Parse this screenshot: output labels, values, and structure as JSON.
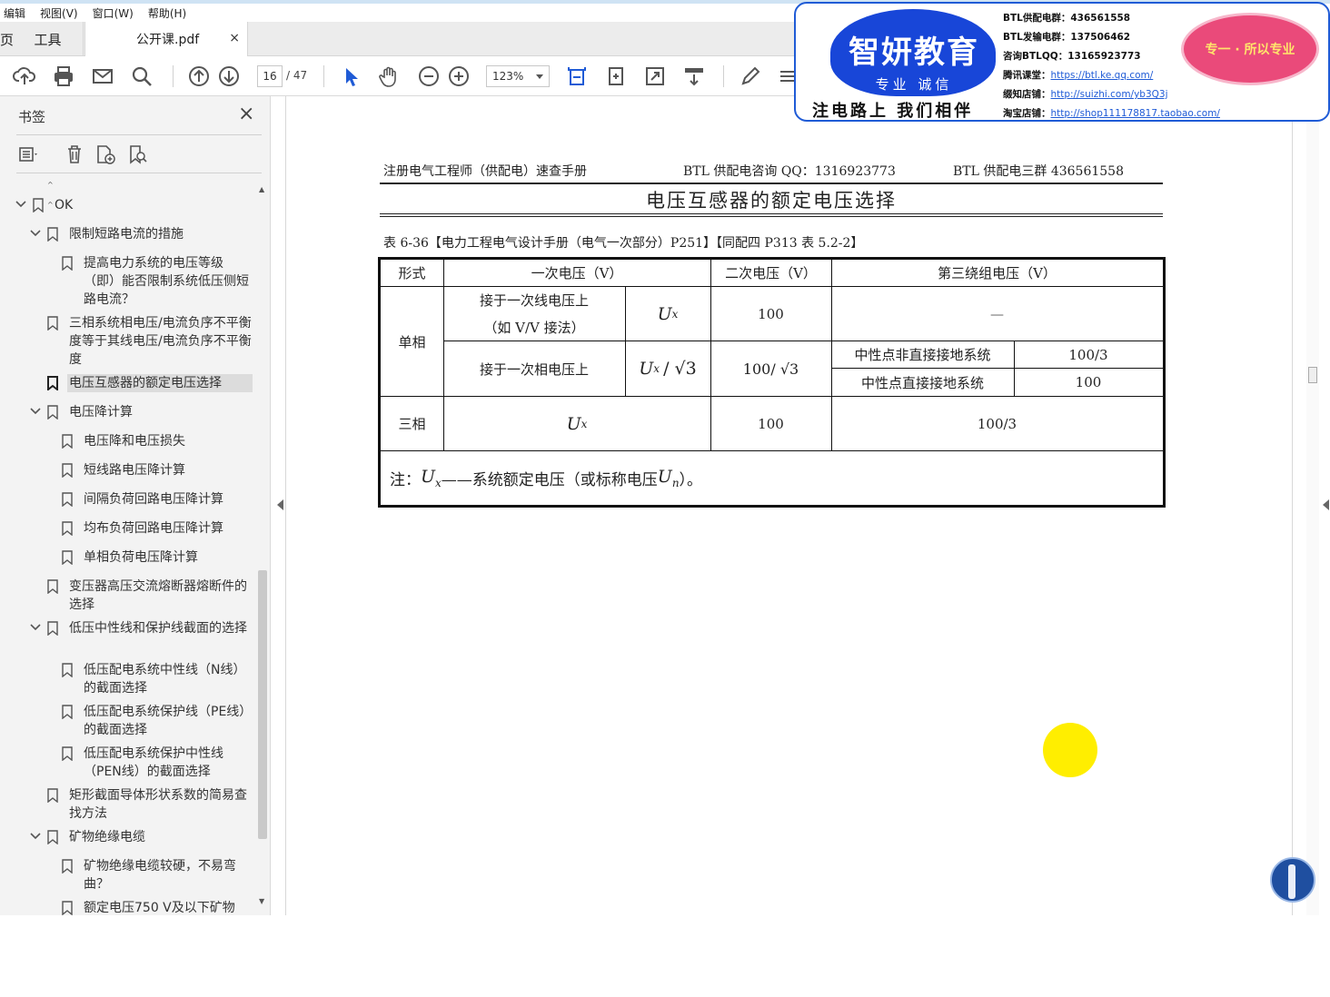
{
  "menu": [
    "编辑",
    "视图(V)",
    "窗口(W)",
    "帮助(H)"
  ],
  "tabs": {
    "home": "页",
    "tools": "工具",
    "file": "公开课.pdf",
    "close": "×"
  },
  "toolbar": {
    "page_current": "16",
    "page_total": "/ 47",
    "zoom": "123%"
  },
  "sidebar": {
    "title": "书签",
    "close": "×",
    "bookmarks": [
      {
        "label": "OK",
        "level": 0,
        "expanded": true
      },
      {
        "label": "限制短路电流的措施",
        "level": 1,
        "expanded": true
      },
      {
        "label": "提高电力系统的电压等级（即）能否限制系统低压侧短路电流？",
        "level": 2
      },
      {
        "label": "三相系统相电压/电流负序不平衡度等于其线电压/电流负序不平衡度",
        "level": 1
      },
      {
        "label": "电压互感器的额定电压选择",
        "level": 1,
        "selected": true
      },
      {
        "label": "电压降计算",
        "level": 1,
        "expanded": true
      },
      {
        "label": "电压降和电压损失",
        "level": 2
      },
      {
        "label": "短线路电压降计算",
        "level": 2
      },
      {
        "label": "间隔负荷回路电压降计算",
        "level": 2
      },
      {
        "label": "均布负荷回路电压降计算",
        "level": 2
      },
      {
        "label": "单相负荷电压降计算",
        "level": 2
      },
      {
        "label": "变压器高压交流熔断器熔断件的选择",
        "level": 1
      },
      {
        "label": "低压中性线和保护线截面的选择",
        "level": 1,
        "expanded": true
      },
      {
        "label": "低压配电系统中性线（N线）的截面选择",
        "level": 2
      },
      {
        "label": "低压配电系统保护线（PE线）的截面选择",
        "level": 2
      },
      {
        "label": "低压配电系统保护中性线（PEN线）的截面选择",
        "level": 2
      },
      {
        "label": "矩形截面导体形状系数的简易查找方法",
        "level": 1
      },
      {
        "label": "矿物绝缘电缆",
        "level": 1,
        "expanded": true
      },
      {
        "label": "矿物绝缘电缆较硬，不易弯曲？",
        "level": 2
      },
      {
        "label": "额定电压750 V及以下矿物",
        "level": 2
      }
    ]
  },
  "page": {
    "header_left": "注册电气工程师（供配电）速查手册",
    "header_mid": "BTL 供配电咨询 QQ：1316923773",
    "header_right": "BTL 供配电三群 436561558",
    "title": "电压互感器的额定电压选择",
    "caption": "表 6-36【电力工程电气设计手册（电气一次部分）P251】【同配四 P313 表 5.2-2】",
    "table": {
      "h_form": "形式",
      "h_primary": "一次电压（V）",
      "h_secondary": "二次电压（V）",
      "h_tertiary": "第三绕组电压（V）",
      "single": "单相",
      "three": "三相",
      "line_conn_1": "接于一次线电压上",
      "line_conn_2": "（如 V/V 接法）",
      "phase_conn": "接于一次相电压上",
      "ux": "U",
      "ux_sub": "x",
      "sqrt": "/ √3",
      "sec_100": "100",
      "sec_100_sqrt": "100/ √3",
      "dash": "—",
      "neutral_indirect": "中性点非直接接地系统",
      "neutral_direct": "中性点直接接地系统",
      "v_100_3": "100/3",
      "v_100": "100",
      "three_sec": "100",
      "three_ter": "100/3",
      "note_prefix": "注：",
      "note_text": "——系统额定电压（或标称电压",
      "note_un": "U",
      "note_un_sub": "n",
      "note_end": "）。"
    }
  },
  "promo": {
    "logo": "智妍教育",
    "logo_sub": "专业 诚信",
    "slogan": "注电路上 我们相伴",
    "line1": "BTL供配电群：436561558",
    "line2": "BTL发输电群：137506462",
    "line3": "咨询BTLQQ：13165923773",
    "line4_label": "腾讯课堂：",
    "line4_link": "https://btl.ke.qq.com/",
    "line5_label": "缀知店铺：",
    "line5_link": "http://suizhi.com/yb3Q3j",
    "line6_label": "淘宝店铺：",
    "line6_link": "http://shop111178817.taobao.com/",
    "oval": "专一 · 所以专业"
  },
  "colors": {
    "accent": "#1f5bd6",
    "pointer": "#ffee00",
    "oval": "#ea4a7a"
  }
}
